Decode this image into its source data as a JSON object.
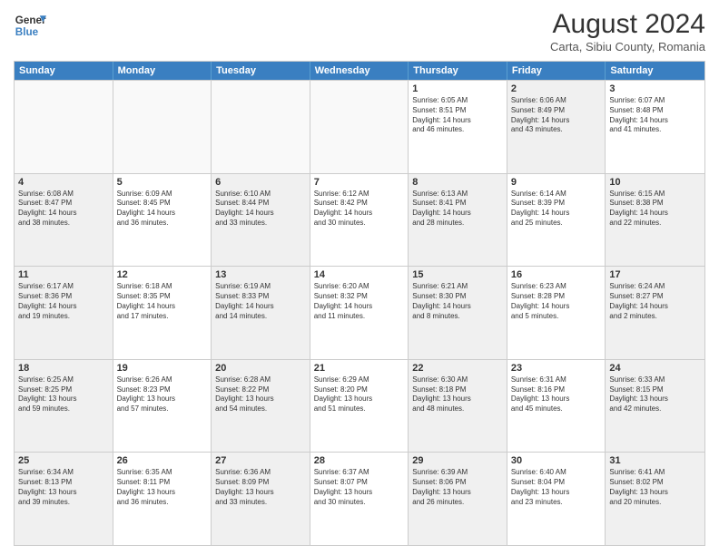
{
  "header": {
    "logo_line1": "General",
    "logo_line2": "Blue",
    "month": "August 2024",
    "location": "Carta, Sibiu County, Romania"
  },
  "days": [
    "Sunday",
    "Monday",
    "Tuesday",
    "Wednesday",
    "Thursday",
    "Friday",
    "Saturday"
  ],
  "weeks": [
    [
      {
        "day": "",
        "info": "",
        "empty": true
      },
      {
        "day": "",
        "info": "",
        "empty": true
      },
      {
        "day": "",
        "info": "",
        "empty": true
      },
      {
        "day": "",
        "info": "",
        "empty": true
      },
      {
        "day": "1",
        "info": "Sunrise: 6:05 AM\nSunset: 8:51 PM\nDaylight: 14 hours\nand 46 minutes.",
        "empty": false
      },
      {
        "day": "2",
        "info": "Sunrise: 6:06 AM\nSunset: 8:49 PM\nDaylight: 14 hours\nand 43 minutes.",
        "empty": false,
        "shaded": true
      },
      {
        "day": "3",
        "info": "Sunrise: 6:07 AM\nSunset: 8:48 PM\nDaylight: 14 hours\nand 41 minutes.",
        "empty": false
      }
    ],
    [
      {
        "day": "4",
        "info": "Sunrise: 6:08 AM\nSunset: 8:47 PM\nDaylight: 14 hours\nand 38 minutes.",
        "empty": false,
        "shaded": true
      },
      {
        "day": "5",
        "info": "Sunrise: 6:09 AM\nSunset: 8:45 PM\nDaylight: 14 hours\nand 36 minutes.",
        "empty": false
      },
      {
        "day": "6",
        "info": "Sunrise: 6:10 AM\nSunset: 8:44 PM\nDaylight: 14 hours\nand 33 minutes.",
        "empty": false,
        "shaded": true
      },
      {
        "day": "7",
        "info": "Sunrise: 6:12 AM\nSunset: 8:42 PM\nDaylight: 14 hours\nand 30 minutes.",
        "empty": false
      },
      {
        "day": "8",
        "info": "Sunrise: 6:13 AM\nSunset: 8:41 PM\nDaylight: 14 hours\nand 28 minutes.",
        "empty": false,
        "shaded": true
      },
      {
        "day": "9",
        "info": "Sunrise: 6:14 AM\nSunset: 8:39 PM\nDaylight: 14 hours\nand 25 minutes.",
        "empty": false
      },
      {
        "day": "10",
        "info": "Sunrise: 6:15 AM\nSunset: 8:38 PM\nDaylight: 14 hours\nand 22 minutes.",
        "empty": false,
        "shaded": true
      }
    ],
    [
      {
        "day": "11",
        "info": "Sunrise: 6:17 AM\nSunset: 8:36 PM\nDaylight: 14 hours\nand 19 minutes.",
        "empty": false,
        "shaded": true
      },
      {
        "day": "12",
        "info": "Sunrise: 6:18 AM\nSunset: 8:35 PM\nDaylight: 14 hours\nand 17 minutes.",
        "empty": false
      },
      {
        "day": "13",
        "info": "Sunrise: 6:19 AM\nSunset: 8:33 PM\nDaylight: 14 hours\nand 14 minutes.",
        "empty": false,
        "shaded": true
      },
      {
        "day": "14",
        "info": "Sunrise: 6:20 AM\nSunset: 8:32 PM\nDaylight: 14 hours\nand 11 minutes.",
        "empty": false
      },
      {
        "day": "15",
        "info": "Sunrise: 6:21 AM\nSunset: 8:30 PM\nDaylight: 14 hours\nand 8 minutes.",
        "empty": false,
        "shaded": true
      },
      {
        "day": "16",
        "info": "Sunrise: 6:23 AM\nSunset: 8:28 PM\nDaylight: 14 hours\nand 5 minutes.",
        "empty": false
      },
      {
        "day": "17",
        "info": "Sunrise: 6:24 AM\nSunset: 8:27 PM\nDaylight: 14 hours\nand 2 minutes.",
        "empty": false,
        "shaded": true
      }
    ],
    [
      {
        "day": "18",
        "info": "Sunrise: 6:25 AM\nSunset: 8:25 PM\nDaylight: 13 hours\nand 59 minutes.",
        "empty": false,
        "shaded": true
      },
      {
        "day": "19",
        "info": "Sunrise: 6:26 AM\nSunset: 8:23 PM\nDaylight: 13 hours\nand 57 minutes.",
        "empty": false
      },
      {
        "day": "20",
        "info": "Sunrise: 6:28 AM\nSunset: 8:22 PM\nDaylight: 13 hours\nand 54 minutes.",
        "empty": false,
        "shaded": true
      },
      {
        "day": "21",
        "info": "Sunrise: 6:29 AM\nSunset: 8:20 PM\nDaylight: 13 hours\nand 51 minutes.",
        "empty": false
      },
      {
        "day": "22",
        "info": "Sunrise: 6:30 AM\nSunset: 8:18 PM\nDaylight: 13 hours\nand 48 minutes.",
        "empty": false,
        "shaded": true
      },
      {
        "day": "23",
        "info": "Sunrise: 6:31 AM\nSunset: 8:16 PM\nDaylight: 13 hours\nand 45 minutes.",
        "empty": false
      },
      {
        "day": "24",
        "info": "Sunrise: 6:33 AM\nSunset: 8:15 PM\nDaylight: 13 hours\nand 42 minutes.",
        "empty": false,
        "shaded": true
      }
    ],
    [
      {
        "day": "25",
        "info": "Sunrise: 6:34 AM\nSunset: 8:13 PM\nDaylight: 13 hours\nand 39 minutes.",
        "empty": false,
        "shaded": true
      },
      {
        "day": "26",
        "info": "Sunrise: 6:35 AM\nSunset: 8:11 PM\nDaylight: 13 hours\nand 36 minutes.",
        "empty": false
      },
      {
        "day": "27",
        "info": "Sunrise: 6:36 AM\nSunset: 8:09 PM\nDaylight: 13 hours\nand 33 minutes.",
        "empty": false,
        "shaded": true
      },
      {
        "day": "28",
        "info": "Sunrise: 6:37 AM\nSunset: 8:07 PM\nDaylight: 13 hours\nand 30 minutes.",
        "empty": false
      },
      {
        "day": "29",
        "info": "Sunrise: 6:39 AM\nSunset: 8:06 PM\nDaylight: 13 hours\nand 26 minutes.",
        "empty": false,
        "shaded": true
      },
      {
        "day": "30",
        "info": "Sunrise: 6:40 AM\nSunset: 8:04 PM\nDaylight: 13 hours\nand 23 minutes.",
        "empty": false
      },
      {
        "day": "31",
        "info": "Sunrise: 6:41 AM\nSunset: 8:02 PM\nDaylight: 13 hours\nand 20 minutes.",
        "empty": false,
        "shaded": true
      }
    ]
  ]
}
